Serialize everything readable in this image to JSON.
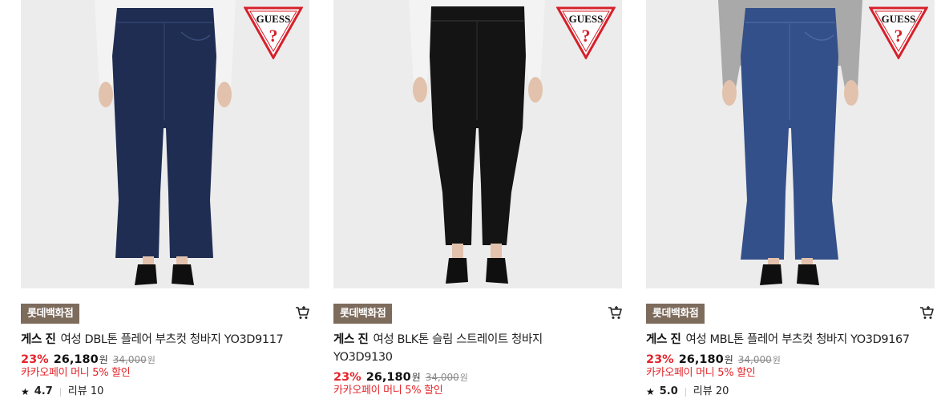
{
  "products": [
    {
      "store": "롯데백화점",
      "brand": "게스 진",
      "name": "여성 DBL톤 플레어 부츠컷 청바지 YO3D9117",
      "discount_rate": "23%",
      "price": "26,180",
      "currency": "원",
      "original_price": "34,000",
      "original_currency": "원",
      "promo": "카카오페이 머니 5% 할인",
      "rating": "4.7",
      "review_label": "리뷰",
      "review_count": "10",
      "jean_color": "#1f2d52",
      "top_color": "#f3f3f3",
      "cut": "flare"
    },
    {
      "store": "롯데백화점",
      "brand": "게스 진",
      "name": "여성 BLK톤 슬림 스트레이트 청바지 YO3D9130",
      "discount_rate": "23%",
      "price": "26,180",
      "currency": "원",
      "original_price": "34,000",
      "original_currency": "원",
      "promo": "카카오페이 머니 5% 할인",
      "jean_color": "#141414",
      "top_color": "#f3f3f3",
      "cut": "straight"
    },
    {
      "store": "롯데백화점",
      "brand": "게스 진",
      "name": "여성 MBL톤 플레어 부츠컷 청바지 YO3D9167",
      "discount_rate": "23%",
      "price": "26,180",
      "currency": "원",
      "original_price": "34,000",
      "original_currency": "원",
      "promo": "카카오페이 머니 5% 할인",
      "rating": "5.0",
      "review_label": "리뷰",
      "review_count": "20",
      "jean_color": "#34508a",
      "top_color": "#a9a9a9",
      "cut": "flare"
    }
  ],
  "logo_text": "GUESS",
  "icons": {
    "cart": "cart-icon",
    "star": "star-icon"
  },
  "colors": {
    "accent_red": "#e4252b",
    "badge_brown": "#7d6b5c",
    "photo_bg": "#ebebeb"
  }
}
